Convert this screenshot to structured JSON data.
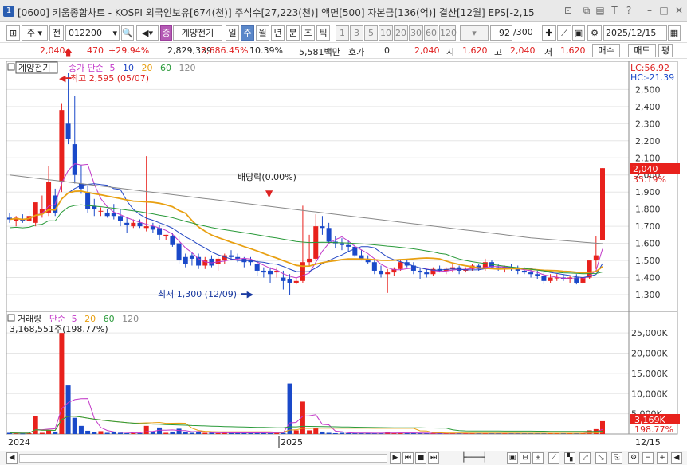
{
  "title": {
    "badge": "1",
    "text": "[0600] 키움종합차트 - KOSPI 외국인보유[674(천)] 주식수[27,223(천)] 액면[500] 자본금[136(억)] 결산[12월] EPS[-2,15"
  },
  "toolbar": {
    "period_d": "주",
    "period_prefix": "전",
    "code": "012200",
    "name_tag": "증",
    "stock_name": "계양전기",
    "periods": [
      "일",
      "주",
      "월",
      "년",
      "분",
      "초",
      "틱"
    ],
    "selected_period": "주",
    "intervals": [
      "1",
      "3",
      "5",
      "10",
      "20",
      "30",
      "60",
      "120"
    ],
    "count": "92",
    "count_total": "/300",
    "date": "2025/12/15"
  },
  "quote": {
    "price": "2,040",
    "change": "470",
    "change_pct": "+29.94%",
    "volume": "2,829,339",
    "vol_pct": "2,686.45%",
    "turnover_rate": "10.39%",
    "amount": "5,581백만",
    "hoga_label": "호가",
    "hoga": "0",
    "hoga_price": "2,040",
    "open_label": "시",
    "open": "1,620",
    "high_label": "고",
    "high": "2,040",
    "low_label": "저",
    "low": "1,620",
    "buy": "매수",
    "sell": "매도",
    "eval": "평"
  },
  "price_panel": {
    "name": "계양전기",
    "ma_label": "종가 단순",
    "ma_periods": [
      "5",
      "10",
      "20",
      "60",
      "120"
    ],
    "max_label": "최고 2,595 (05/07)",
    "min_label": "최저 1,300 (12/09)",
    "event_label": "배당락(0.00%)",
    "lc": "LC:56.92",
    "hc": "HC:-21.39",
    "axis": [
      "2,500",
      "2,400",
      "2,300",
      "2,200",
      "2,100",
      "2,000",
      "1,900",
      "1,800",
      "1,700",
      "1,600",
      "1,500",
      "1,400",
      "1,300"
    ],
    "cur_price": "2,040",
    "cur_pct": "35.19%"
  },
  "volume_panel": {
    "label": "거래량",
    "ma_label": "단순",
    "ma_periods": [
      "5",
      "20",
      "60",
      "120"
    ],
    "last": "3,168,551주(198.77%)",
    "axis": [
      "25,000K",
      "20,000K",
      "15,000K",
      "10,000K",
      "5,000K"
    ],
    "cur": "3,169K",
    "cur_pct": "198.77%"
  },
  "xaxis": {
    "labels": [
      "2024",
      "2025"
    ],
    "right": "12/15"
  },
  "colors": {
    "up": "#e8211c",
    "down": "#1a49c9",
    "ma5": "#c238c8",
    "ma10": "#2347c4",
    "ma20": "#e8a012",
    "ma60": "#2a9a3a",
    "ma120": "#888888"
  },
  "chart_data": {
    "type": "candlestick",
    "ylim": [
      1250,
      2620
    ],
    "ohlc": [
      [
        1750,
        1780,
        1720,
        1740
      ],
      [
        1730,
        1760,
        1700,
        1750
      ],
      [
        1740,
        1770,
        1720,
        1730
      ],
      [
        1730,
        1790,
        1710,
        1760
      ],
      [
        1720,
        1830,
        1700,
        1840
      ],
      [
        1780,
        1880,
        1750,
        1800
      ],
      [
        1780,
        2050,
        1760,
        1960
      ],
      [
        1880,
        1920,
        1760,
        1780
      ],
      [
        1960,
        2420,
        1900,
        2380
      ],
      [
        2300,
        2595,
        2180,
        2210
      ],
      [
        2180,
        2460,
        1950,
        2000
      ],
      [
        1950,
        2060,
        1890,
        1920
      ],
      [
        1900,
        1940,
        1780,
        1800
      ],
      [
        1820,
        1860,
        1760,
        1800
      ],
      [
        1790,
        1810,
        1760,
        1790
      ],
      [
        1780,
        1800,
        1750,
        1760
      ],
      [
        1780,
        1830,
        1740,
        1760
      ],
      [
        1760,
        1800,
        1700,
        1730
      ],
      [
        1720,
        1750,
        1660,
        1710
      ],
      [
        1700,
        1740,
        1690,
        1720
      ],
      [
        1720,
        1740,
        1690,
        1700
      ],
      [
        1690,
        2110,
        1670,
        1700
      ],
      [
        1700,
        1720,
        1660,
        1680
      ],
      [
        1690,
        1710,
        1620,
        1650
      ],
      [
        1640,
        1650,
        1620,
        1650
      ],
      [
        1640,
        1660,
        1580,
        1590
      ],
      [
        1600,
        1640,
        1480,
        1500
      ],
      [
        1520,
        1540,
        1460,
        1480
      ],
      [
        1530,
        1550,
        1470,
        1510
      ],
      [
        1520,
        1540,
        1450,
        1470
      ],
      [
        1470,
        1520,
        1450,
        1500
      ],
      [
        1510,
        1530,
        1460,
        1470
      ],
      [
        1480,
        1520,
        1440,
        1510
      ],
      [
        1500,
        1540,
        1480,
        1530
      ],
      [
        1530,
        1560,
        1500,
        1520
      ],
      [
        1520,
        1540,
        1490,
        1510
      ],
      [
        1510,
        1520,
        1460,
        1490
      ],
      [
        1500,
        1520,
        1470,
        1490
      ],
      [
        1480,
        1500,
        1410,
        1440
      ],
      [
        1440,
        1460,
        1400,
        1430
      ],
      [
        1440,
        1460,
        1370,
        1420
      ],
      [
        1430,
        1460,
        1400,
        1440
      ],
      [
        1400,
        1440,
        1330,
        1380
      ],
      [
        1390,
        1420,
        1300,
        1370
      ],
      [
        1370,
        1400,
        1360,
        1380
      ],
      [
        1380,
        1820,
        1370,
        1490
      ],
      [
        1490,
        1650,
        1470,
        1510
      ],
      [
        1510,
        1770,
        1500,
        1700
      ],
      [
        1700,
        1760,
        1650,
        1690
      ],
      [
        1690,
        1720,
        1600,
        1610
      ],
      [
        1610,
        1640,
        1570,
        1600
      ],
      [
        1600,
        1630,
        1560,
        1590
      ],
      [
        1590,
        1620,
        1550,
        1580
      ],
      [
        1580,
        1600,
        1520,
        1530
      ],
      [
        1530,
        1560,
        1500,
        1510
      ],
      [
        1510,
        1530,
        1480,
        1490
      ],
      [
        1490,
        1500,
        1420,
        1440
      ],
      [
        1440,
        1470,
        1400,
        1420
      ],
      [
        1420,
        1450,
        1310,
        1430
      ],
      [
        1430,
        1460,
        1410,
        1450
      ],
      [
        1450,
        1500,
        1440,
        1490
      ],
      [
        1490,
        1510,
        1460,
        1470
      ],
      [
        1470,
        1490,
        1420,
        1440
      ],
      [
        1440,
        1460,
        1390,
        1430
      ],
      [
        1430,
        1450,
        1400,
        1420
      ],
      [
        1420,
        1460,
        1410,
        1450
      ],
      [
        1450,
        1470,
        1430,
        1440
      ],
      [
        1440,
        1460,
        1420,
        1450
      ],
      [
        1450,
        1480,
        1430,
        1460
      ],
      [
        1460,
        1470,
        1420,
        1440
      ],
      [
        1440,
        1460,
        1430,
        1450
      ],
      [
        1450,
        1480,
        1440,
        1470
      ],
      [
        1470,
        1480,
        1440,
        1450
      ],
      [
        1450,
        1510,
        1440,
        1490
      ],
      [
        1490,
        1500,
        1450,
        1460
      ],
      [
        1460,
        1480,
        1440,
        1450
      ],
      [
        1450,
        1470,
        1430,
        1460
      ],
      [
        1460,
        1480,
        1440,
        1450
      ],
      [
        1450,
        1470,
        1420,
        1440
      ],
      [
        1440,
        1460,
        1420,
        1430
      ],
      [
        1430,
        1450,
        1400,
        1420
      ],
      [
        1420,
        1440,
        1390,
        1410
      ],
      [
        1410,
        1430,
        1360,
        1380
      ],
      [
        1380,
        1420,
        1370,
        1400
      ],
      [
        1400,
        1420,
        1380,
        1400
      ],
      [
        1400,
        1420,
        1380,
        1390
      ],
      [
        1390,
        1410,
        1370,
        1400
      ],
      [
        1400,
        1420,
        1360,
        1370
      ],
      [
        1370,
        1410,
        1360,
        1400
      ],
      [
        1400,
        1470,
        1390,
        1500
      ],
      [
        1500,
        1640,
        1450,
        1530
      ],
      [
        1620,
        2040,
        1620,
        2040
      ]
    ],
    "volume": [
      300,
      200,
      150,
      200,
      4500,
      300,
      900,
      600,
      25000,
      12000,
      4000,
      2000,
      800,
      500,
      700,
      300,
      400,
      300,
      200,
      300,
      200,
      2000,
      500,
      1600,
      300,
      600,
      1300,
      400,
      300,
      500,
      300,
      300,
      200,
      400,
      300,
      300,
      300,
      200,
      400,
      300,
      200,
      400,
      300,
      12500,
      900,
      8000,
      900,
      1500,
      600,
      300,
      200,
      300,
      200,
      300,
      200,
      200,
      200,
      200,
      400,
      300,
      300,
      200,
      200,
      200,
      200,
      200,
      200,
      200,
      200,
      200,
      200,
      200,
      200,
      200,
      200,
      200,
      200,
      200,
      200,
      200,
      200,
      200,
      200,
      200,
      200,
      200,
      200,
      200,
      200,
      900,
      1200,
      3169
    ]
  }
}
